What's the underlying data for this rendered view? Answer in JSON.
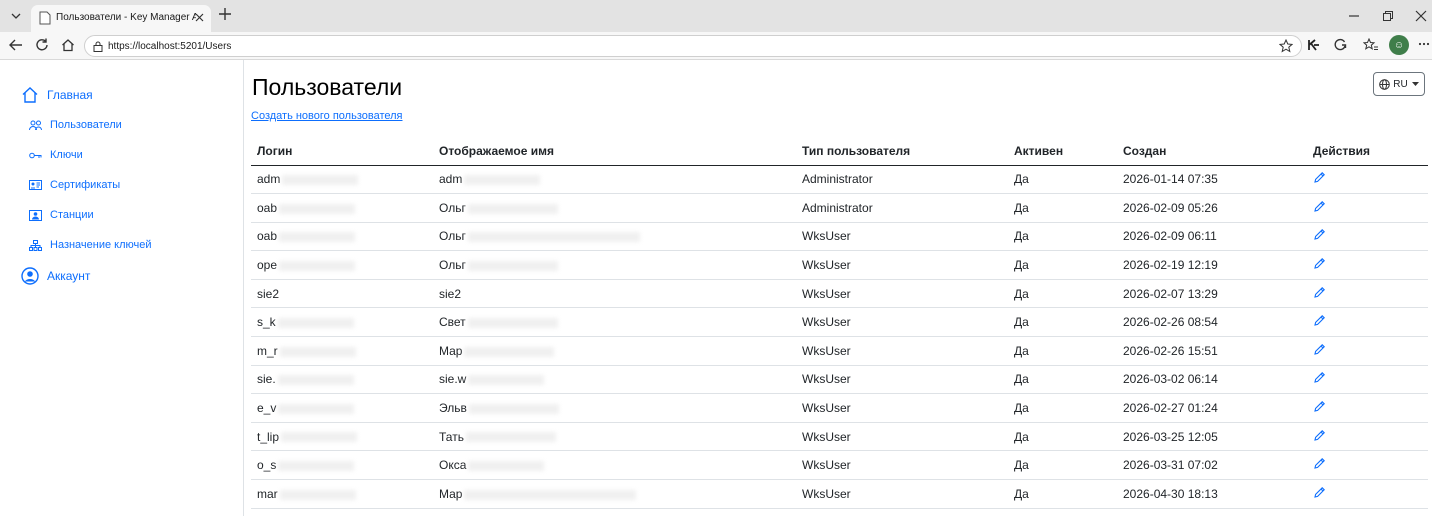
{
  "browser": {
    "tab_title": "Пользователи - Key Manager Admin",
    "url": "https://localhost:5201/Users"
  },
  "sidebar": {
    "items": [
      {
        "label": "Главная",
        "icon": "home-icon"
      },
      {
        "label": "Пользователи",
        "icon": "users-icon"
      },
      {
        "label": "Ключи",
        "icon": "key-icon"
      },
      {
        "label": "Сертификаты",
        "icon": "certificate-icon"
      },
      {
        "label": "Станции",
        "icon": "station-icon"
      },
      {
        "label": "Назначение ключей",
        "icon": "key-assignment-icon"
      },
      {
        "label": "Аккаунт",
        "icon": "account-icon"
      }
    ]
  },
  "main": {
    "title": "Пользователи",
    "create_link": "Создать нового пользователя",
    "language": "RU"
  },
  "table": {
    "columns": [
      "Логин",
      "Отображаемое имя",
      "Тип пользователя",
      "Активен",
      "Создан",
      "Действия"
    ],
    "rows": [
      {
        "login": "adm",
        "name": "adm",
        "type": "Administrator",
        "active": "Да",
        "created": "2026-01-14 07:35"
      },
      {
        "login": "oab",
        "name": "Ольг",
        "type": "Administrator",
        "active": "Да",
        "created": "2026-02-09 05:26"
      },
      {
        "login": "oab",
        "name": "Ольг",
        "type": "WksUser",
        "active": "Да",
        "created": "2026-02-09 06:11"
      },
      {
        "login": "ope",
        "name": "Ольг",
        "type": "WksUser",
        "active": "Да",
        "created": "2026-02-19 12:19"
      },
      {
        "login": "sie2",
        "name": "sie2",
        "type": "WksUser",
        "active": "Да",
        "created": "2026-02-07 13:29"
      },
      {
        "login": "s_k",
        "name": "Свет",
        "type": "WksUser",
        "active": "Да",
        "created": "2026-02-26 08:54"
      },
      {
        "login": "m_r",
        "name": "Мар",
        "type": "WksUser",
        "active": "Да",
        "created": "2026-02-26 15:51"
      },
      {
        "login": "sie.",
        "name": "sie.w",
        "type": "WksUser",
        "active": "Да",
        "created": "2026-03-02 06:14"
      },
      {
        "login": "e_v",
        "name": "Эльв",
        "type": "WksUser",
        "active": "Да",
        "created": "2026-02-27 01:24"
      },
      {
        "login": "t_lip",
        "name": "Тать",
        "type": "WksUser",
        "active": "Да",
        "created": "2026-03-25 12:05"
      },
      {
        "login": "o_s",
        "name": "Окса",
        "type": "WksUser",
        "active": "Да",
        "created": "2026-03-31 07:02"
      },
      {
        "login": "mar",
        "name": "Мар",
        "type": "WksUser",
        "active": "Да",
        "created": "2026-04-30 18:13"
      }
    ]
  },
  "colors": {
    "link": "#0d6efd",
    "text": "#212529"
  }
}
